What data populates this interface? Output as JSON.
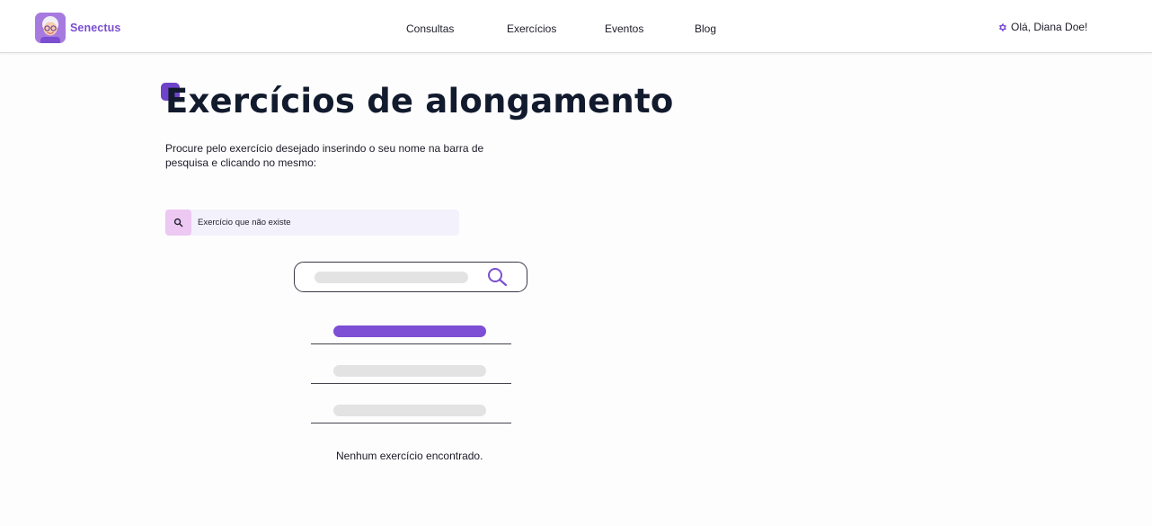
{
  "header": {
    "brand": "Senectus",
    "nav": [
      "Consultas",
      "Exercícios",
      "Eventos",
      "Blog"
    ],
    "user_greeting": "Olá, Diana Doe!"
  },
  "main": {
    "title": "Exercícios de alongamento",
    "description": "Procure pelo exercício desejado inserindo o seu nome na barra de pesquisa e clicando no mesmo:",
    "search": {
      "value": "Exercício que não existe"
    },
    "empty_message": "Nenhum exercício encontrado."
  },
  "colors": {
    "brand_purple": "#7b4fd0",
    "accent_purple": "#6f43c9",
    "search_button_bg": "#ecc8f2",
    "search_bg": "#f3f1fb",
    "title_color": "#121a2d"
  },
  "icons": {
    "user": "gear-icon",
    "search": "search-icon"
  }
}
